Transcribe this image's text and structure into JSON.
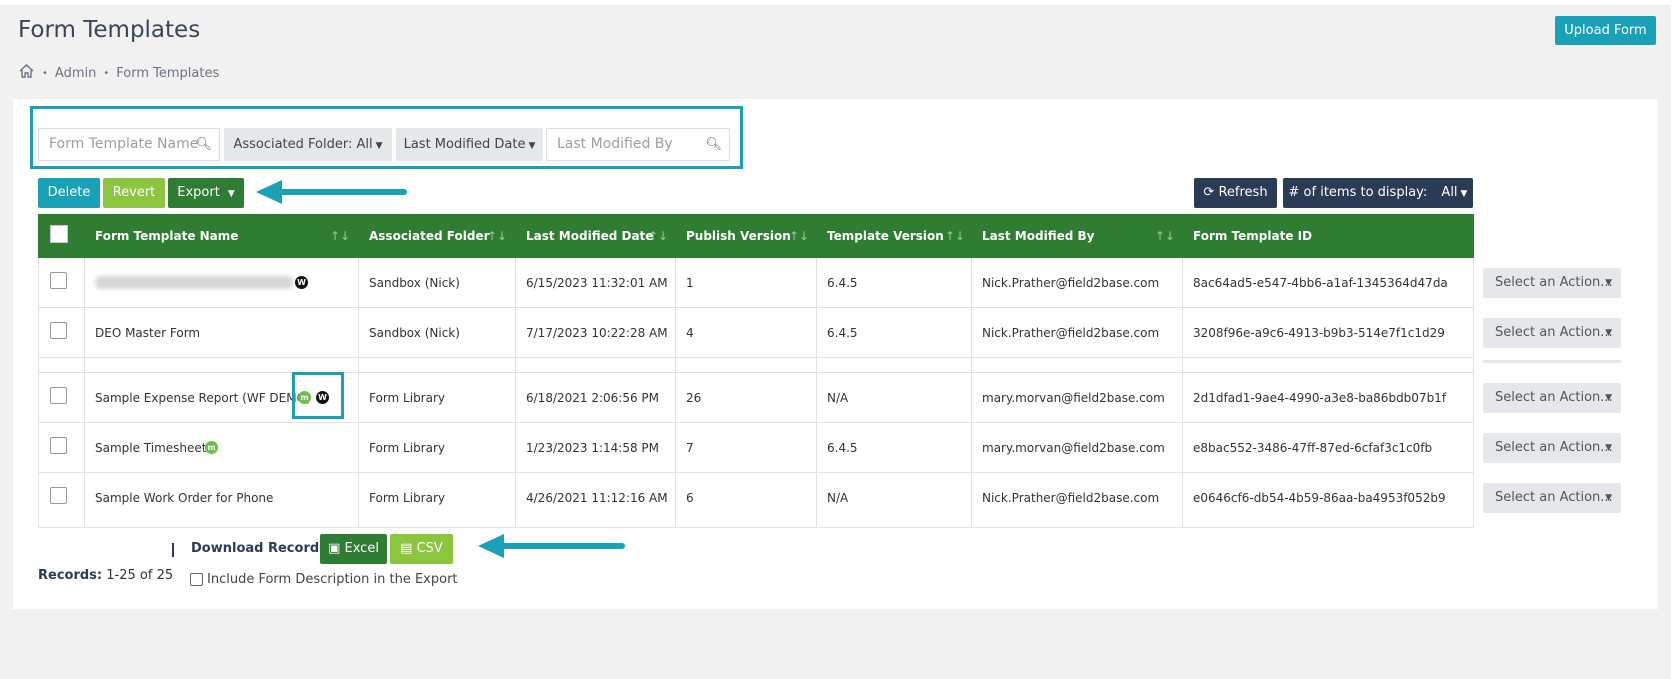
{
  "page": {
    "title": "Form Templates",
    "upload_label": "Upload Form"
  },
  "breadcrumb": {
    "items": [
      "Admin",
      "Form Templates"
    ]
  },
  "filters": {
    "name_placeholder": "Form Template Name",
    "folder_label": "Associated Folder: All",
    "date_label": "Last Modified Date",
    "modified_by_placeholder": "Last Modified By"
  },
  "toolbar": {
    "delete_label": "Delete",
    "revert_label": "Revert",
    "export_label": "Export",
    "refresh_label": "Refresh",
    "items_label": "# of items to display:",
    "items_value": "All"
  },
  "table": {
    "columns": [
      "Form Template Name",
      "Associated Folder",
      "Last Modified Date",
      "Publish Version",
      "Template Version",
      "Last Modified By",
      "Form Template ID"
    ],
    "rows": [
      {
        "name": "",
        "folder": "Sandbox (Nick)",
        "date": "6/15/2023 11:32:01 AM",
        "publish": "1",
        "template": "6.4.5",
        "by": "Nick.Prather@field2base.com",
        "id": "8ac64ad5-e547-4bb6-a1af-1345364d47da",
        "action": "Select an Action..."
      },
      {
        "name": "DEO Master Form",
        "folder": "Sandbox (Nick)",
        "date": "7/17/2023 10:22:28 AM",
        "publish": "4",
        "template": "6.4.5",
        "by": "Nick.Prather@field2base.com",
        "id": "3208f96e-a9c6-4913-b9b3-514e7f1c1d29",
        "action": "Select an Action..."
      },
      {
        "name": "Sample Expense Report (WF DEMO)",
        "folder": "Form Library",
        "date": "6/18/2021 2:06:56 PM",
        "publish": "26",
        "template": "N/A",
        "by": "mary.morvan@field2base.com",
        "id": "2d1dfad1-9ae4-4990-a3e8-ba86bdb07b1f",
        "action": "Select an Action..."
      },
      {
        "name": "Sample Timesheet",
        "folder": "Form Library",
        "date": "1/23/2023 1:14:58 PM",
        "publish": "7",
        "template": "6.4.5",
        "by": "mary.morvan@field2base.com",
        "id": "e8bac552-3486-47ff-87ed-6cfaf3c1c0fb",
        "action": "Select an Action..."
      },
      {
        "name": "Sample Work Order for Phone",
        "folder": "Form Library",
        "date": "4/26/2021 11:12:16 AM",
        "publish": "6",
        "template": "N/A",
        "by": "Nick.Prather@field2base.com",
        "id": "e0646cf6-db54-4b59-86aa-ba4953f052b9",
        "action": "Select an Action..."
      }
    ]
  },
  "footer": {
    "download_label": "Download Records",
    "excel_label": "Excel",
    "csv_label": "CSV",
    "records_label": "Records:",
    "records_value": "1-25 of 25",
    "include_label": "Include Form Description in the Export"
  },
  "colors": {
    "accent": "#1aa1b7",
    "header_green": "#2e7d32",
    "light_green": "#8cc63f",
    "dark_navy": "#2a3b55"
  }
}
